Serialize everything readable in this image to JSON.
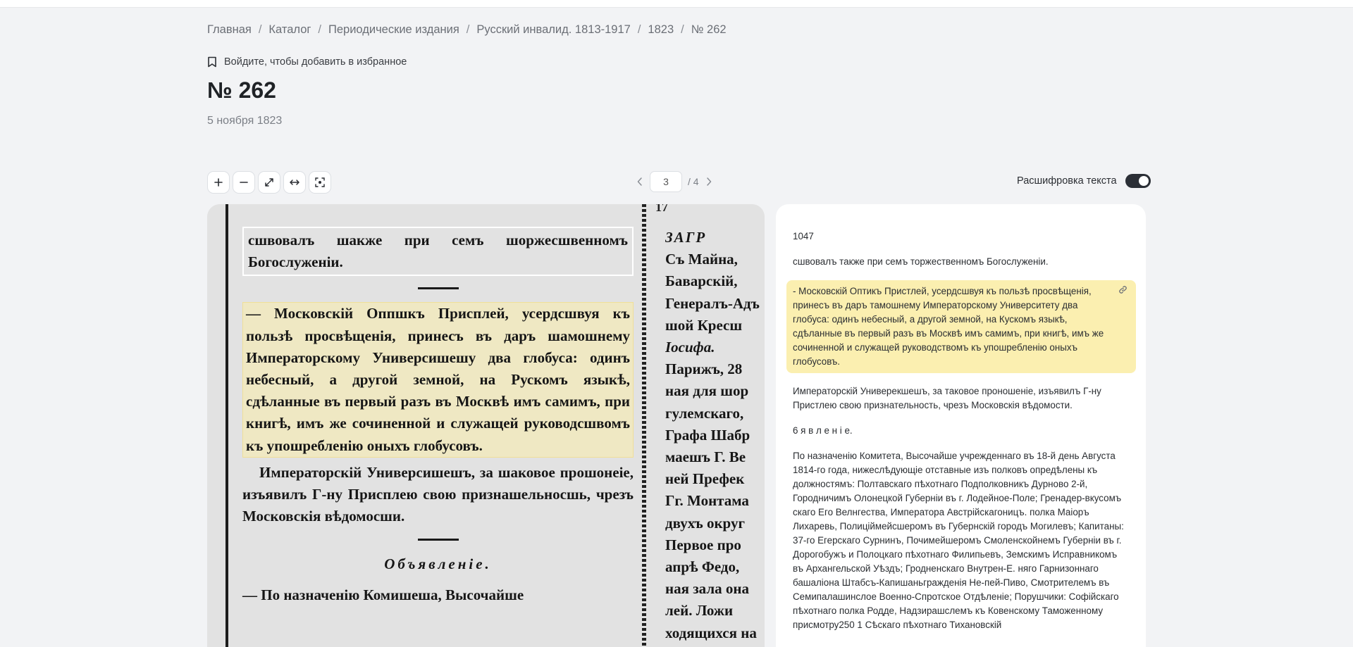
{
  "breadcrumb": {
    "home": "Главная",
    "catalog": "Каталог",
    "periodicals": "Периодические издания",
    "publication": "Русский инвалид. 1813-1917",
    "year": "1823",
    "issue": "№ 262",
    "separator": "/"
  },
  "favorite": {
    "label": "Войдите, чтобы добавить в избранное",
    "icon": "bookmark-icon"
  },
  "page": {
    "title": "№ 262",
    "date": "5 ноября 1823"
  },
  "toolbar": {
    "buttons": [
      {
        "name": "zoom-in-button",
        "icon": "plus-icon"
      },
      {
        "name": "zoom-out-button",
        "icon": "minus-icon"
      },
      {
        "name": "fullscreen-button",
        "icon": "expand-icon"
      },
      {
        "name": "fit-width-button",
        "icon": "horizontal-arrows-icon"
      },
      {
        "name": "fit-page-button",
        "icon": "focus-icon"
      }
    ]
  },
  "pager": {
    "current": "3",
    "total": "/ 4"
  },
  "transcription": {
    "label": "Расшифровка текста",
    "enabled": true
  },
  "scan": {
    "page_number": "17",
    "col1": {
      "top": "сшвовалъ шакже при семъ шоржесшвенномъ Богослуженiи.",
      "highlight": "— Московскiй Оппшкъ Присплей, усердсшвуя къ пользѣ просвѣщенiя, принесъ въ даръ шамошнему Императорскому Универсишешу два глобуса: одинъ небесный, а другой земной, на Рускомъ языкѣ, сдѣланные въ первый разъ въ Москвѣ имъ самимъ, при книгѣ, имъ же сочиненной и служащей руководсшвомъ къ упошребленiю оныхъ глобусовъ.",
      "para2": "Императорскiй Универсишешъ, за шаковое прошонеiе, изъявилъ Г-ну Присплею свою признашельносшь, чрезъ Московскiя вѣдомосши.",
      "heading": "Объявленiе.",
      "para3": "— По назначенiю Комишеша, Высочайше"
    },
    "col2": {
      "lines": [
        "ЗАГР",
        "Съ Майна,",
        "Баварскiй, ",
        "Генералъ-Адъ",
        "шой Кресш",
        "Iосифа.",
        "Парижъ, 28",
        "ная для шор",
        "гулемскаго,",
        "Графа Шабр",
        "маешъ Г. Ве",
        "ней Префек",
        "Гг. Монтама",
        "двухъ округ",
        "Первое про",
        "апрѣ Федо,",
        "ная зала она",
        "лей.  Ложи",
        "ходящихся на"
      ]
    }
  },
  "panel": {
    "page_no": "1047",
    "blocks": [
      "сшвовалъ также при семъ торжественномъ Богослуженiи.",
      "- Московскiй Оптикъ Пристлей, усердсшвуя къ пользѣ просвѣщенiя, принесъ въ даръ тамошнему Императорскому Университету два глобуса: одинъ небесный, а другой земной, на Кускомъ языкѣ, сдѣланные въ первый разъ въ Москвѣ имъ самимъ, при книгѣ, имъ же сочиненной и служащей руководствомъ къ упошребленiю оныхъ глобусовъ.",
      "Императорскiй Универекшешъ, за таковое проношенiе, изъявилъ Г-ну Пристлею свою признательность, чрезъ Московскiя вѣдомости.",
      "6 я в л е н i е.",
      "По назначенiю Комитета, Высочайше учрежденнаго въ 18-й день Августа 1814-го года, нижеслѣдующiе отставные изъ полковъ опредѣлены къ должностямъ: Полтавскаго пѣхотнаго Подполковникъ Дурново 2-й, Городничимъ Олонецкой Губернiи въ г. Лодейное-Поле; Гренадер-вкусомъ скаго Его Велнгества, Императора Австрiйскагоницъ. полка Маiоръ Лихаревь, Полицiймейсшеромъ въ Губернскiй городъ Могилевъ; Капитаны: 37-го Егерскаго Сурнинъ, Почимейшеромъ Смоленскойнемъ Губернiи въ г. Дорогобужъ и Полоцкаго пѣхотнаго Филипьевъ, Земскимъ Исправникомъ въ Архангельской Уѣздъ; Гродненскаго Внутрен-Е. няго Гарнизоннаго башалiона Штабсъ-Капишаньгражденiя Не-пей-Пиво, Смотрителемъ въ Семипалашинслое Военно-Спротское Отдѣленiе; Порушчики: Софiйскаго пѣхотнаго полка Родде, Надзирашслемъ къ Ковенскому Таможенному присмотру250 1 Сѣскаго пѣхотнаго Тихановскiй"
    ],
    "active_block": 1,
    "link_icon": "link-icon"
  },
  "colors": {
    "background": "#f2f3f5",
    "highlight": "#fbefb0",
    "toggle_on": "#2b2f36"
  }
}
